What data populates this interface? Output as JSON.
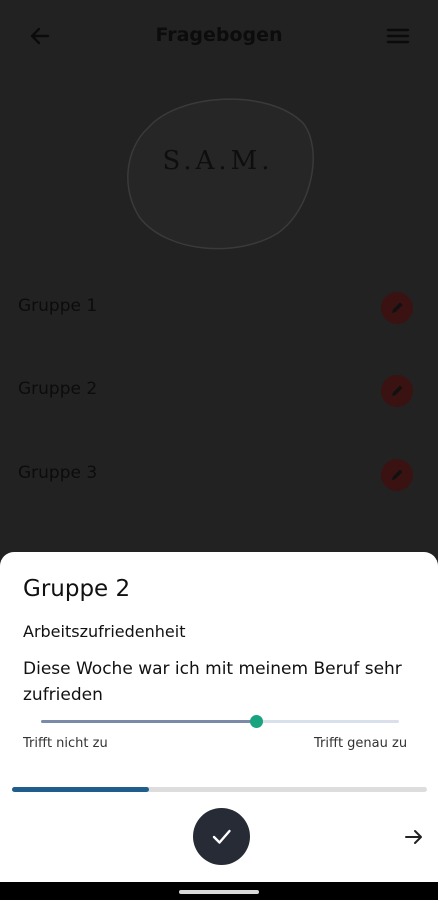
{
  "header": {
    "title": "Fragebogen",
    "back_icon": "arrow-left-icon",
    "menu_icon": "hamburger-menu-icon"
  },
  "logo": {
    "title": "S.A.M.",
    "subtitle_line1": "",
    "subtitle_line2": ""
  },
  "groups": [
    {
      "label": "Gruppe 1",
      "status_icon": "pencil-icon"
    },
    {
      "label": "Gruppe 2",
      "status_icon": "pencil-icon"
    },
    {
      "label": "Gruppe 3",
      "status_icon": "pencil-icon"
    }
  ],
  "sheet": {
    "title": "Gruppe 2",
    "category": "Arbeitszufriedenheit",
    "question": "Diese Woche war ich mit meinem Beruf sehr zufrieden",
    "scale_min_label": "Trifft nicht zu",
    "scale_max_label": "Trifft genau zu",
    "slider_value": 0.6,
    "progress": 0.33,
    "submit_icon": "checkmark-icon",
    "next_icon": "arrow-right-icon"
  },
  "colors": {
    "overlay_background": "#222222",
    "slider_thumb": "#1aa37f",
    "progress_fill": "#1f5e8c",
    "submit_button": "#262b36",
    "check_badge": "#3a1212"
  }
}
